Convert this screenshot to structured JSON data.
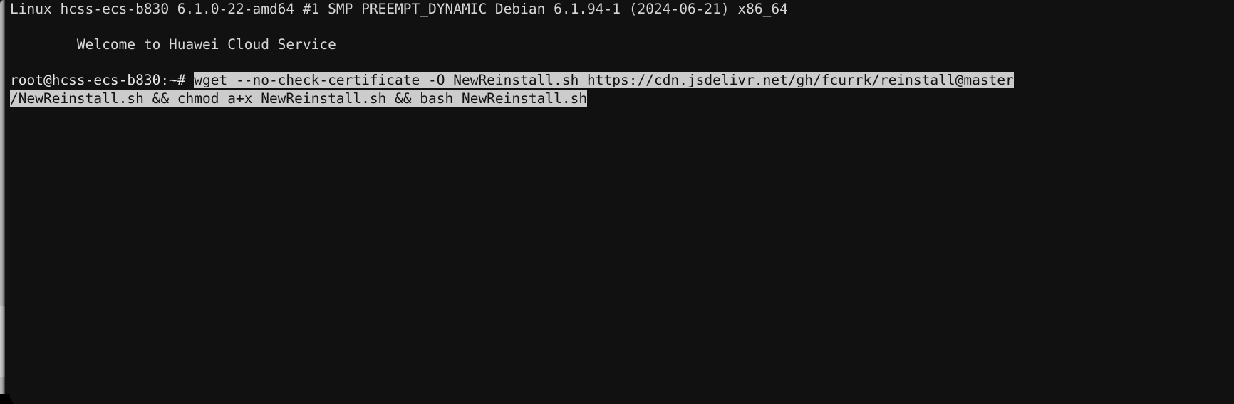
{
  "terminal": {
    "background_color": "#111111",
    "foreground_color": "#d6d6d6",
    "selection_background_color": "#cccccc",
    "selection_foreground_color": "#111111",
    "lines": {
      "kernel_banner": "Linux hcss-ecs-b830 6.1.0-22-amd64 #1 SMP PREEMPT_DYNAMIC Debian 6.1.94-1 (2024-06-21) x86_64",
      "blank_1": "",
      "welcome": "        Welcome to Huawei Cloud Service",
      "blank_2": "",
      "prompt": "root@hcss-ecs-b830:~# ",
      "command_segment_1": "wget --no-check-certificate -O NewReinstall.sh https://cdn.jsdelivr.net/gh/fcurrk/reinstall@master",
      "command_segment_2": "/NewReinstall.sh && chmod a+x NewReinstall.sh && bash NewReinstall.sh"
    },
    "command_full": "wget --no-check-certificate -O NewReinstall.sh https://cdn.jsdelivr.net/gh/fcurrk/reinstall@master/NewReinstall.sh && chmod a+x NewReinstall.sh && bash NewReinstall.sh",
    "user": "root",
    "hostname": "hcss-ecs-b830",
    "cwd": "~",
    "prompt_symbol": "#"
  }
}
